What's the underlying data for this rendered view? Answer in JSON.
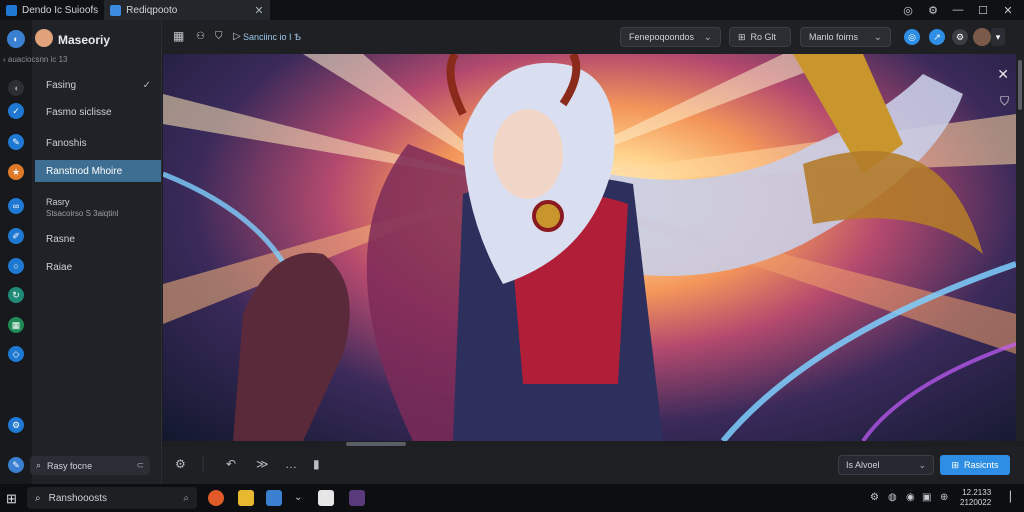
{
  "tabs": [
    {
      "label": "Dendo Ic Suioofs"
    },
    {
      "label": "Rediqpooto"
    }
  ],
  "tab_close": "✕",
  "window_controls": [
    "◎",
    "⚙",
    "—",
    "☐",
    "✕"
  ],
  "account": {
    "name": "Maseoriy",
    "subtitle": "‹ auaciocsnn ic 13"
  },
  "nav": {
    "items": [
      {
        "label": "Fasing",
        "check": "✓"
      },
      {
        "label": "Fasmo siclisse"
      },
      {
        "label": "Fanoshis"
      },
      {
        "label": "Ranstnod Mhoire"
      },
      {
        "label": "Rasry",
        "sub": "Stsacoirso S 3aiqtinl"
      },
      {
        "label": "Rasne"
      },
      {
        "label": "Raiae"
      }
    ],
    "search": "Rasy focne"
  },
  "toolbar": {
    "crumb": "Sanciinc io I Ѣ",
    "dropdown1": "Fenepoqoondos",
    "dropdown2": "Ro Glt",
    "dropdown3": "Manlo foirns"
  },
  "bottom": {
    "select": "Is Alvoel",
    "primary": "Rasicnts"
  },
  "taskbar": {
    "search": "Ranshooosts",
    "clock_time": "12.2133",
    "clock_date": "2120022"
  },
  "colors": {
    "accent": "#2e8ee6",
    "selected": "#3f6e93"
  }
}
